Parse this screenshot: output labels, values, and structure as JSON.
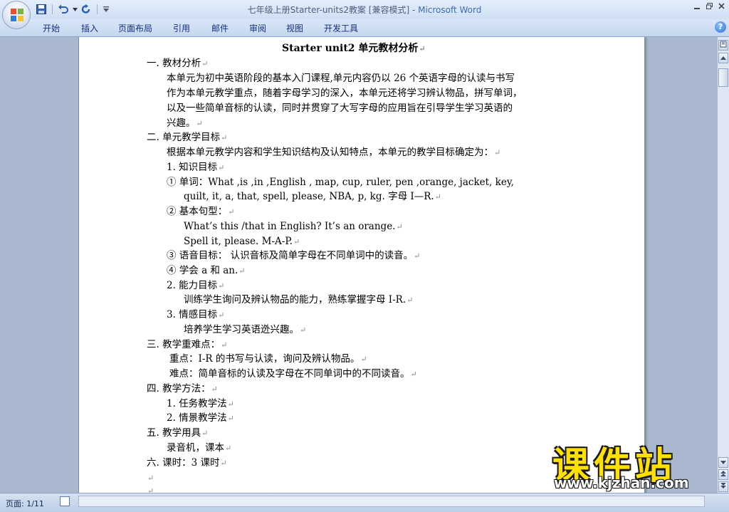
{
  "window": {
    "title_doc": "七年级上册Starter-units2教案 [兼容模式] - ",
    "title_app": "Microsoft Word"
  },
  "quick_access": {
    "icons": [
      "save-icon",
      "undo-icon",
      "dropdown-icon",
      "redo-icon",
      "customize-icon"
    ]
  },
  "ribbon": {
    "tabs": [
      "开始",
      "插入",
      "页面布局",
      "引用",
      "邮件",
      "审阅",
      "视图",
      "开发工具"
    ],
    "help_label": "?"
  },
  "document": {
    "paragraph_mark": "↵",
    "lines": [
      "Starter unit2 单元教材分析",
      "一.      教材分析",
      "本单元为初中英语阶段的基本入门课程,单元内容仍以 26 个英语字母的认读与书写",
      "作为本单元教学重点，随着字母学习的深入，本单元还将学习辨认物品，拼写单词，",
      "以及一些简单音标的认读，同时并贯穿了大写字母的应用旨在引导学生学习英语的",
      "兴趣。",
      "二.      单元教学目标",
      "根据本单元教学内容和学生知识结构及认知特点，本单元的教学目标确定为：",
      "1. 知识目标",
      "① 单词：What ,is ,in ,English , map, cup, ruler, pen ,orange, jacket, key,",
      "quilt, it, a, that, spell, please, NBA, p, kg.  字母 I—R.",
      "② 基本句型：",
      "What’s this /that in English?    It’s an orange.",
      "Spell it, please. M-A-P.",
      "③ 语音目标： 认识音标及简单字母在不同单词中的读音。",
      "④  学会 a 和 an.",
      "2. 能力目标",
      "训练学生询问及辨认物品的能力，熟练掌握字母 I-R.",
      "3. 情感目标",
      "培养学生学习英语迯兴趣。",
      "三. 教学重难点：",
      "重点：I-R 的书写与认读，询问及辨认物品。",
      "难点：简单音标的认读及字母在不同单词中的不同读音。",
      "四. 教学方法：",
      "1. 任务教学法",
      "2. 情景教学法",
      "五.  教学用具",
      "录音机，课本",
      "六. 课时：3 课时",
      "",
      ""
    ]
  },
  "status": {
    "page": "页面: 1/11"
  },
  "watermark": {
    "title": "课件站",
    "url": "www.kjzhan.com"
  },
  "colors": {
    "accent": "#3e6bb5",
    "ribbon": "#c5d7ef",
    "watermark": "#ffe000"
  }
}
